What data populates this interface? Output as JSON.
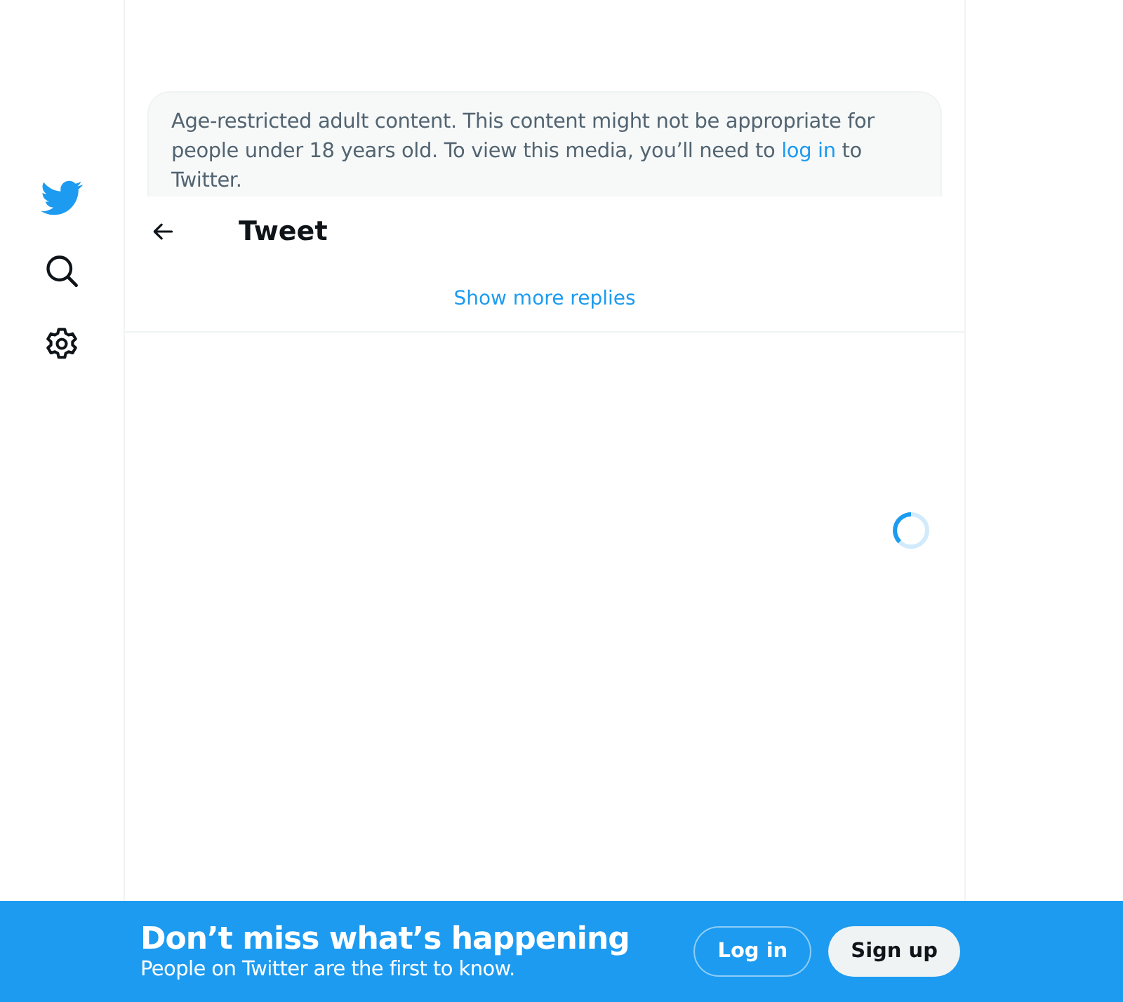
{
  "sidebar": {
    "items": [
      {
        "kind": "logo"
      },
      {
        "kind": "search"
      },
      {
        "kind": "settings"
      }
    ]
  },
  "notice": {
    "text_before": "Age-restricted adult content. This content might not be appropriate for people under 18 years old. To view this media, you’ll need to ",
    "link": "log in",
    "text_after": " to Twitter."
  },
  "header": {
    "title": "Tweet"
  },
  "show_more": "Show more replies",
  "loading": true,
  "banner": {
    "title": "Don’t miss what’s happening",
    "subtitle": "People on Twitter are the first to know.",
    "buttons": [
      {
        "label": "Log in",
        "kind": "outline"
      },
      {
        "label": "Sign up",
        "kind": "filled"
      }
    ]
  }
}
